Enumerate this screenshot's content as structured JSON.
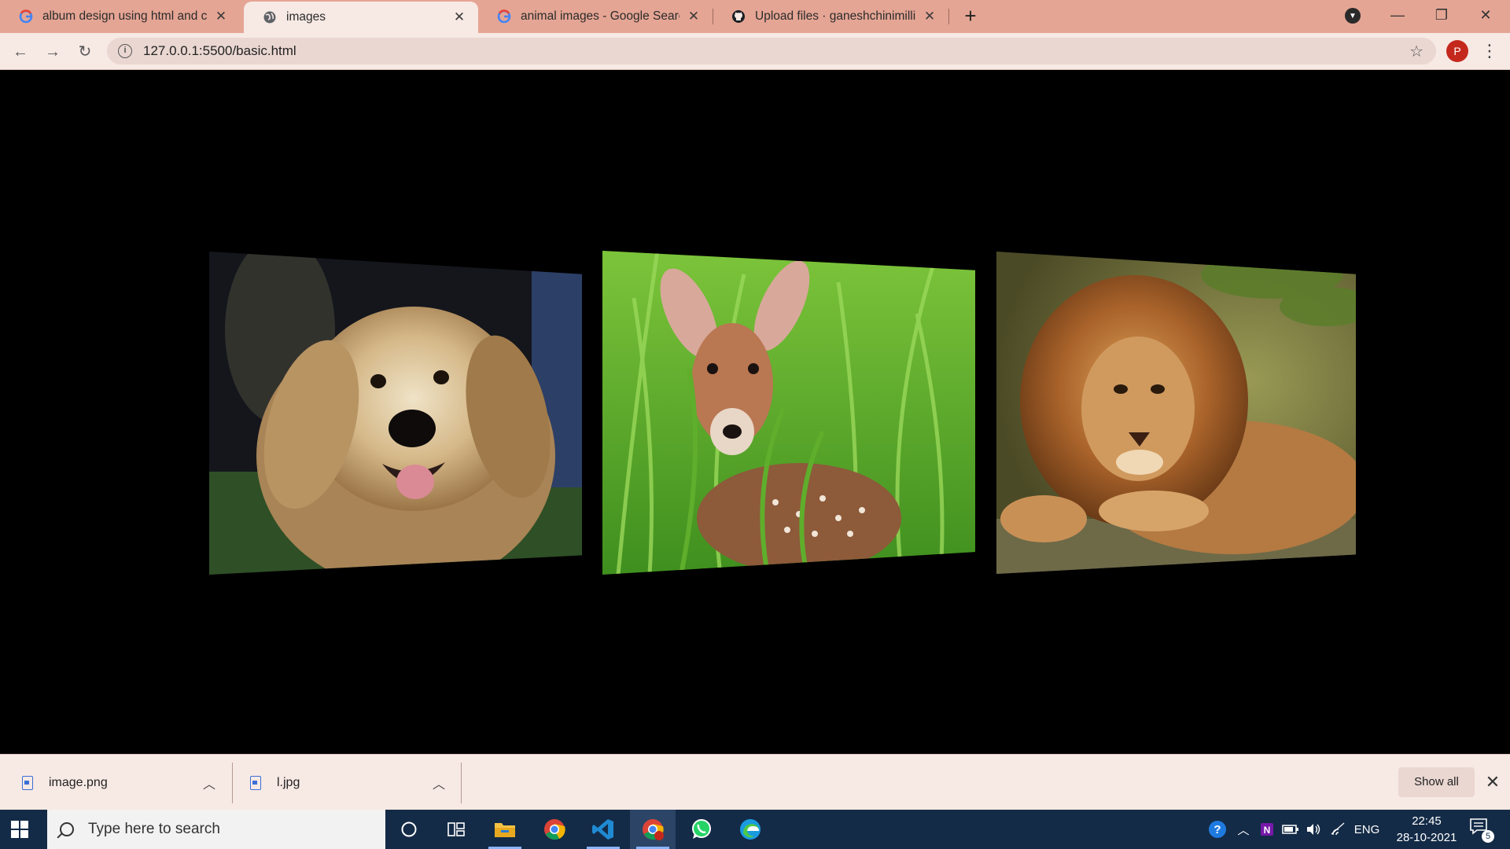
{
  "browser": {
    "tabs": [
      {
        "title": "album design using html and css",
        "icon": "google-icon",
        "active": false
      },
      {
        "title": "images",
        "icon": "globe-icon",
        "active": true
      },
      {
        "title": "animal images - Google Search",
        "icon": "google-icon",
        "active": false
      },
      {
        "title": "Upload files · ganeshchinimilli/im",
        "icon": "github-icon",
        "active": false
      }
    ],
    "new_tab_label": "+",
    "url": "127.0.0.1:5500/basic.html",
    "profile_initial": "P"
  },
  "page": {
    "background": "#000000",
    "images": [
      {
        "subject": "golden retriever dog",
        "icon": "dog-photo"
      },
      {
        "subject": "spotted fawn in grass",
        "icon": "fawn-photo"
      },
      {
        "subject": "lion lying on rock",
        "icon": "lion-photo"
      }
    ]
  },
  "downloads": {
    "items": [
      {
        "filename": "image.png"
      },
      {
        "filename": "l.jpg"
      }
    ],
    "show_all_label": "Show all"
  },
  "taskbar": {
    "search_placeholder": "Type here to search",
    "language": "ENG",
    "time": "22:45",
    "date": "28-10-2021",
    "notification_count": "5",
    "apps": [
      "cortana-icon",
      "task-view-icon",
      "file-explorer-icon",
      "chrome-icon",
      "vscode-icon",
      "chrome-profile-icon",
      "whatsapp-icon",
      "edge-icon"
    ]
  },
  "colors": {
    "tabstrip": "#e5a594",
    "toolbar": "#f7e9e4",
    "taskbar": "#142b47",
    "avatar": "#c4281c"
  }
}
